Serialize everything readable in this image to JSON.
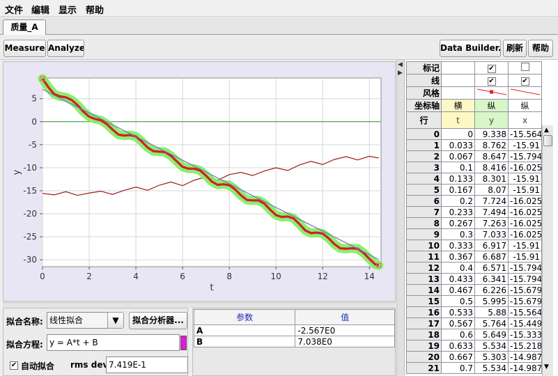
{
  "menu": [
    "文件",
    "编辑",
    "显示",
    "帮助"
  ],
  "tab": {
    "label": "质量_A"
  },
  "toolbar": {
    "measure": "Measure",
    "analyze": "Analyze",
    "data_builder": "Data Builder...",
    "refresh": "刷新",
    "help": "帮助"
  },
  "chart_data": {
    "type": "line",
    "xlabel": "t",
    "ylabel": "y",
    "xlim": [
      0,
      14.5
    ],
    "ylim": [
      -31.5,
      9.5
    ],
    "xticks": [
      "0",
      "2",
      "4",
      "6",
      "8",
      "10",
      "12",
      "14"
    ],
    "yticks": [
      "5",
      "0",
      "-5",
      "-10",
      "-15",
      "-20",
      "-25",
      "-30"
    ],
    "series": [
      {
        "name": "y",
        "color": "#d41f1f",
        "values": [
          [
            0,
            9.338
          ],
          [
            0.25,
            7.5
          ],
          [
            0.5,
            5.995
          ],
          [
            0.75,
            5.5
          ],
          [
            1.0,
            5.3
          ],
          [
            1.25,
            4.7
          ],
          [
            1.5,
            3.6
          ],
          [
            1.75,
            2.2
          ],
          [
            2.0,
            1.1
          ],
          [
            2.25,
            0.6
          ],
          [
            2.5,
            0.3
          ],
          [
            2.75,
            -0.5
          ],
          [
            3.0,
            -1.7
          ],
          [
            3.25,
            -2.8
          ],
          [
            3.5,
            -3.0
          ],
          [
            3.75,
            -2.9
          ],
          [
            4.0,
            -3.2
          ],
          [
            4.25,
            -4.3
          ],
          [
            4.5,
            -5.6
          ],
          [
            4.75,
            -6.4
          ],
          [
            5.0,
            -6.5
          ],
          [
            5.25,
            -6.6
          ],
          [
            5.5,
            -7.4
          ],
          [
            5.75,
            -8.6
          ],
          [
            6.0,
            -9.8
          ],
          [
            6.25,
            -10.2
          ],
          [
            6.5,
            -10.2
          ],
          [
            6.75,
            -10.6
          ],
          [
            7.0,
            -11.7
          ],
          [
            7.25,
            -13.0
          ],
          [
            7.5,
            -13.7
          ],
          [
            7.75,
            -13.6
          ],
          [
            8.0,
            -13.8
          ],
          [
            8.25,
            -14.7
          ],
          [
            8.5,
            -16.0
          ],
          [
            8.75,
            -17.0
          ],
          [
            9.0,
            -17.1
          ],
          [
            9.25,
            -17.1
          ],
          [
            9.5,
            -17.8
          ],
          [
            9.75,
            -19.1
          ],
          [
            10.0,
            -20.3
          ],
          [
            10.25,
            -20.7
          ],
          [
            10.5,
            -20.6
          ],
          [
            10.75,
            -21.0
          ],
          [
            11.0,
            -22.2
          ],
          [
            11.25,
            -23.6
          ],
          [
            11.5,
            -24.2
          ],
          [
            11.75,
            -24.1
          ],
          [
            12.0,
            -24.3
          ],
          [
            12.25,
            -25.3
          ],
          [
            12.5,
            -26.6
          ],
          [
            12.75,
            -27.5
          ],
          [
            13.0,
            -27.6
          ],
          [
            13.25,
            -27.5
          ],
          [
            13.5,
            -27.6
          ],
          [
            13.75,
            -28.5
          ],
          [
            14.0,
            -29.8
          ],
          [
            14.25,
            -31.0
          ],
          [
            14.4,
            -31.2
          ]
        ]
      },
      {
        "name": "x",
        "color": "#a01818",
        "values": [
          [
            0,
            -15.564
          ],
          [
            0.5,
            -15.9
          ],
          [
            1.0,
            -15.2
          ],
          [
            1.5,
            -16.0
          ],
          [
            2.0,
            -15.5
          ],
          [
            2.5,
            -15.1
          ],
          [
            3.0,
            -15.8
          ],
          [
            3.5,
            -14.9
          ],
          [
            4.0,
            -14.2
          ],
          [
            4.5,
            -14.9
          ],
          [
            5.0,
            -13.8
          ],
          [
            5.5,
            -13.1
          ],
          [
            6.0,
            -13.9
          ],
          [
            6.5,
            -12.7
          ],
          [
            7.0,
            -12.0
          ],
          [
            7.5,
            -12.7
          ],
          [
            8.0,
            -11.5
          ],
          [
            8.5,
            -11.0
          ],
          [
            9.0,
            -11.7
          ],
          [
            9.5,
            -10.7
          ],
          [
            10.0,
            -10.0
          ],
          [
            10.5,
            -10.6
          ],
          [
            11.0,
            -9.4
          ],
          [
            11.5,
            -8.6
          ],
          [
            12.0,
            -9.3
          ],
          [
            12.5,
            -8.2
          ],
          [
            13.0,
            -7.6
          ],
          [
            13.5,
            -8.3
          ],
          [
            14.0,
            -7.5
          ],
          [
            14.4,
            -7.9
          ]
        ]
      },
      {
        "name": "fit",
        "color": "#7070c0",
        "values": [
          [
            0,
            7.038
          ],
          [
            14.4,
            -29.93
          ]
        ]
      }
    ]
  },
  "fit": {
    "name_label": "拟合名称:",
    "name_value": "线性拟合",
    "analyzer_button": "拟合分析器...",
    "equation_label": "拟合方程:",
    "equation_value": "y = A*t + B",
    "autofit_label": "自动拟合",
    "rms_label": "rms dev:",
    "rms_value": "7.419E-1"
  },
  "params": {
    "headers": [
      "参数",
      "值"
    ],
    "rows": [
      [
        "A",
        "-2.567E0"
      ],
      [
        "B",
        "7.038E0"
      ]
    ]
  },
  "table": {
    "meta_rows": [
      {
        "label": "标记",
        "col1": "✔",
        "col2": ""
      },
      {
        "label": "线",
        "col1": "✔",
        "col2": "✔"
      },
      {
        "label": "风格",
        "col1": "",
        "col2": ""
      },
      {
        "label": "坐标轴",
        "col0": "横",
        "col1": "纵",
        "col2": "纵"
      }
    ],
    "row_header": "行",
    "columns": [
      "t",
      "y",
      "x"
    ],
    "rows": [
      [
        "0",
        "0",
        "9.338",
        "-15.564"
      ],
      [
        "1",
        "0.033",
        "8.762",
        "-15.91"
      ],
      [
        "2",
        "0.067",
        "8.647",
        "-15.794"
      ],
      [
        "3",
        "0.1",
        "8.416",
        "-16.025"
      ],
      [
        "4",
        "0.133",
        "8.301",
        "-15.91"
      ],
      [
        "5",
        "0.167",
        "8.07",
        "-15.91"
      ],
      [
        "6",
        "0.2",
        "7.724",
        "-16.025"
      ],
      [
        "7",
        "0.233",
        "7.494",
        "-16.025"
      ],
      [
        "8",
        "0.267",
        "7.263",
        "-16.025"
      ],
      [
        "9",
        "0.3",
        "7.033",
        "-16.025"
      ],
      [
        "10",
        "0.333",
        "6.917",
        "-15.91"
      ],
      [
        "11",
        "0.367",
        "6.687",
        "-15.91"
      ],
      [
        "12",
        "0.4",
        "6.571",
        "-15.794"
      ],
      [
        "13",
        "0.433",
        "6.341",
        "-15.794"
      ],
      [
        "14",
        "0.467",
        "6.226",
        "-15.679"
      ],
      [
        "15",
        "0.5",
        "5.995",
        "-15.679"
      ],
      [
        "16",
        "0.533",
        "5.88",
        "-15.564"
      ],
      [
        "17",
        "0.567",
        "5.764",
        "-15.449"
      ],
      [
        "18",
        "0.6",
        "5.649",
        "-15.333"
      ],
      [
        "19",
        "0.633",
        "5.534",
        "-15.218"
      ],
      [
        "20",
        "0.667",
        "5.303",
        "-14.987"
      ],
      [
        "21",
        "0.7",
        "5.534",
        "-14.987"
      ]
    ]
  }
}
